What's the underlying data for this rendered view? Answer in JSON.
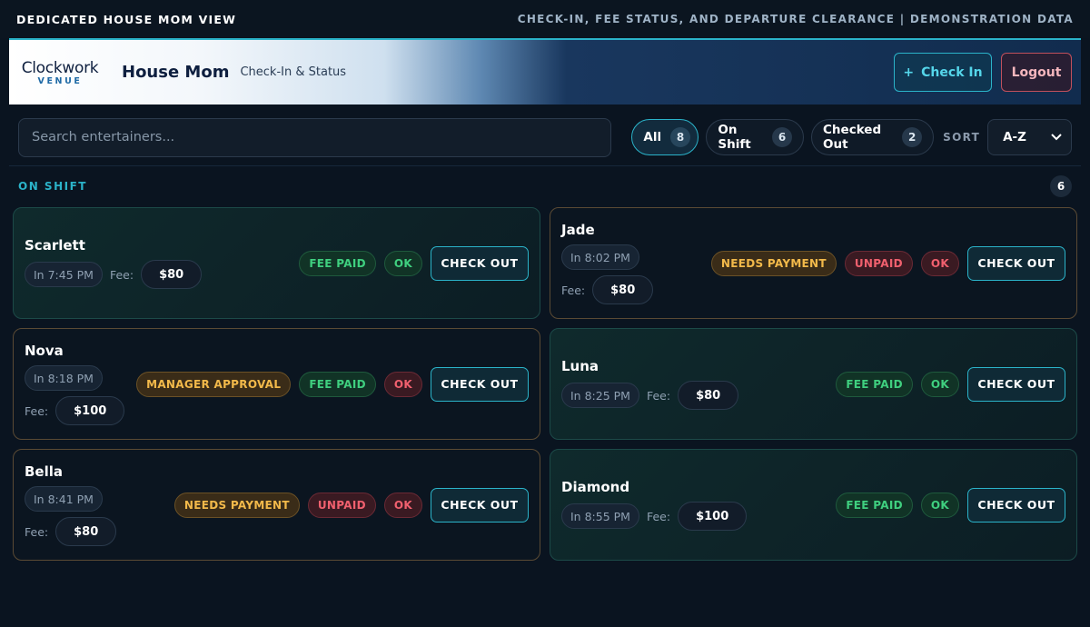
{
  "topbar": {
    "title": "DEDICATED HOUSE MOM VIEW",
    "meta": "CHECK-IN, FEE STATUS, AND DEPARTURE CLEARANCE | DEMONSTRATION DATA"
  },
  "header": {
    "logo_main": "Clockwork",
    "logo_sub": "VENUE",
    "title": "House Mom",
    "subtitle": "Check-In & Status",
    "checkin_icon": "+",
    "checkin_label": "Check In",
    "logout_label": "Logout"
  },
  "toolbar": {
    "search_placeholder": "Search entertainers...",
    "filters": [
      {
        "label": "All",
        "count": "8"
      },
      {
        "label": "On Shift",
        "count": "6"
      },
      {
        "label": "Checked Out",
        "count": "2"
      }
    ],
    "sort_label": "SORT",
    "sort_value": "A-Z"
  },
  "section": {
    "title": "ON SHIFT",
    "count": "6"
  },
  "fee_label": "Fee:",
  "checkout_label": "CHECK OUT",
  "entertainers": [
    {
      "name": "Scarlett",
      "checkin": "In 7:45 PM",
      "fee": "$80",
      "badges": [
        "FEE PAID",
        "OK"
      ]
    },
    {
      "name": "Jade",
      "checkin": "In 8:02 PM",
      "fee": "$80",
      "badges": [
        "NEEDS PAYMENT",
        "UNPAID",
        "OK"
      ]
    },
    {
      "name": "Nova",
      "checkin": "In 8:18 PM",
      "fee": "$100",
      "badges": [
        "MANAGER APPROVAL",
        "FEE PAID",
        "OK"
      ]
    },
    {
      "name": "Luna",
      "checkin": "In 8:25 PM",
      "fee": "$80",
      "badges": [
        "FEE PAID",
        "OK"
      ]
    },
    {
      "name": "Bella",
      "checkin": "In 8:41 PM",
      "fee": "$80",
      "badges": [
        "NEEDS PAYMENT",
        "UNPAID",
        "OK"
      ]
    },
    {
      "name": "Diamond",
      "checkin": "In 8:55 PM",
      "fee": "$100",
      "badges": [
        "FEE PAID",
        "OK"
      ]
    }
  ],
  "colors": {
    "accent": "#2bb3c9",
    "paid_green": "#3fcf7f",
    "unpaid_red": "#f0606e",
    "warning_amber": "#f2b94a"
  },
  "icons": {
    "sort": "chevron-down-icon"
  }
}
